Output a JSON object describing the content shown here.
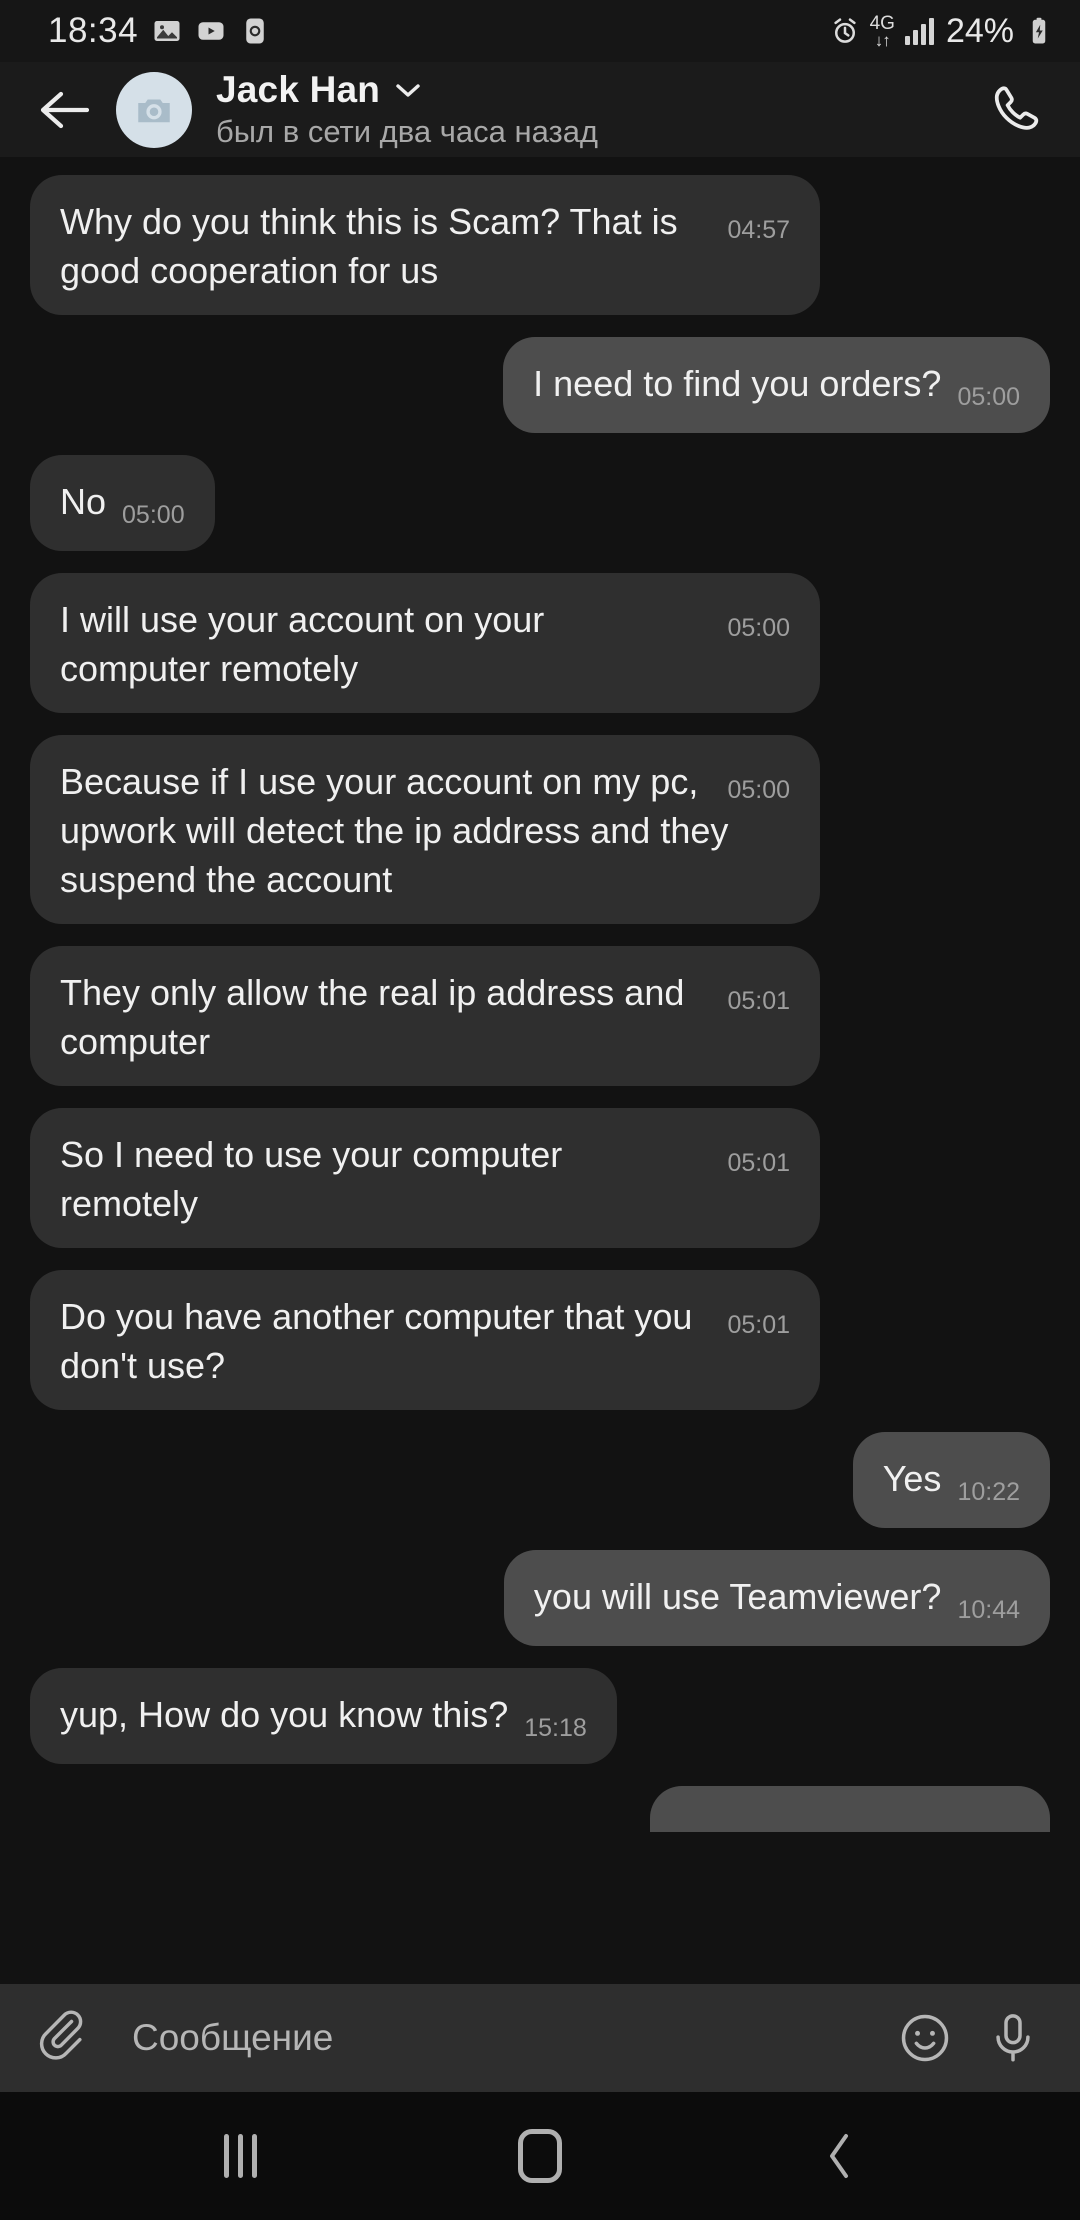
{
  "status_bar": {
    "clock": "18:34",
    "left_icons": [
      "gallery-icon",
      "youtube-icon",
      "clock-app-icon"
    ],
    "alarm_icon": "alarm-icon",
    "network_type": "4G",
    "data_arrows": "↓↑",
    "signal_icon": "signal-bars-icon",
    "battery_percent": "24%",
    "battery_icon": "battery-charging-icon"
  },
  "header": {
    "back_icon": "back-arrow-icon",
    "avatar_icon": "camera-placeholder-icon",
    "chat_name": "Jack Han",
    "dropdown_icon": "chevron-down-icon",
    "chat_status": "был в сети два часа назад",
    "call_icon": "phone-call-icon"
  },
  "messages": [
    {
      "direction": "in",
      "text": "Why do you think this is Scam? That is good cooperation for us",
      "time": "04:57",
      "multiline": true
    },
    {
      "direction": "out",
      "text": "I need to find you orders?",
      "time": "05:00",
      "multiline": false
    },
    {
      "direction": "in",
      "text": "No",
      "time": "05:00",
      "multiline": false
    },
    {
      "direction": "in",
      "text": "I will use your account on your computer remotely",
      "time": "05:00",
      "multiline": true
    },
    {
      "direction": "in",
      "text": "Because if I use your account on my pc, upwork will detect the ip address and they suspend the account",
      "time": "05:00",
      "multiline": true
    },
    {
      "direction": "in",
      "text": "They only allow the real ip address and computer",
      "time": "05:01",
      "multiline": true
    },
    {
      "direction": "in",
      "text": "So I need to use your computer remotely",
      "time": "05:01",
      "multiline": true
    },
    {
      "direction": "in",
      "text": "Do you have another computer that you don't use?",
      "time": "05:01",
      "multiline": true
    },
    {
      "direction": "out",
      "text": "Yes",
      "time": "10:22",
      "multiline": false
    },
    {
      "direction": "out",
      "text": "you will use Teamviewer?",
      "time": "10:44",
      "multiline": false
    },
    {
      "direction": "in",
      "text": "yup, How do you know this?",
      "time": "15:18",
      "multiline": false
    }
  ],
  "input_bar": {
    "attach_icon": "paperclip-icon",
    "placeholder": "Сообщение",
    "emoji_icon": "smiley-icon",
    "mic_icon": "microphone-icon"
  },
  "nav_bar": {
    "recents_icon": "recents-icon",
    "home_icon": "home-icon",
    "back_icon": "back-chevron-icon"
  },
  "colors": {
    "app_background": "#121212",
    "header_background": "#1b1b1b",
    "incoming_bubble": "#2f2f2f",
    "outgoing_bubble": "#4d4d4d",
    "input_bar_background": "#2e2e2e",
    "nav_bar_background": "#0c0c0c",
    "primary_text": "#f0f0f0",
    "secondary_text": "#9e9e9e",
    "avatar_background": "#d5e0e8"
  }
}
